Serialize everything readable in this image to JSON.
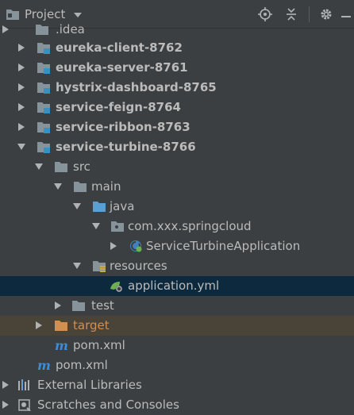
{
  "header": {
    "title": "Project",
    "icons": [
      "folder-icon",
      "dropdown-arrow",
      "locate-icon",
      "collapse-icon",
      "gear-icon",
      "hide-icon"
    ]
  },
  "colors": {
    "background": "#3c3f41",
    "selection": "#0d293e",
    "excluded": "#4a4438",
    "folder": "#87939a",
    "module_badge": "#3592c4",
    "source_folder": "#5a9fd4",
    "target_folder": "#d18f52",
    "text": "#bbbbbb"
  },
  "tree": [
    {
      "label": ".idea",
      "state": "collapsed",
      "icon": "folder-icon",
      "bold": false
    },
    {
      "label": "eureka-client-8762",
      "state": "collapsed",
      "icon": "module-folder-icon",
      "bold": true
    },
    {
      "label": "eureka-server-8761",
      "state": "collapsed",
      "icon": "module-folder-icon",
      "bold": true
    },
    {
      "label": "hystrix-dashboard-8765",
      "state": "collapsed",
      "icon": "module-folder-icon",
      "bold": true
    },
    {
      "label": "service-feign-8764",
      "state": "collapsed",
      "icon": "module-folder-icon",
      "bold": true
    },
    {
      "label": "service-ribbon-8763",
      "state": "collapsed",
      "icon": "module-folder-icon",
      "bold": true
    },
    {
      "label": "service-turbine-8766",
      "state": "expanded",
      "icon": "module-folder-icon",
      "bold": true
    },
    {
      "label": "src",
      "state": "expanded",
      "icon": "folder-icon",
      "bold": false
    },
    {
      "label": "main",
      "state": "expanded",
      "icon": "folder-icon",
      "bold": false
    },
    {
      "label": "java",
      "state": "expanded",
      "icon": "source-folder-icon",
      "bold": false
    },
    {
      "label": "com.xxx.springcloud",
      "state": "expanded",
      "icon": "package-icon",
      "bold": false
    },
    {
      "label": "ServiceTurbineApplication",
      "state": "collapsed",
      "icon": "spring-boot-class-icon",
      "bold": false
    },
    {
      "label": "resources",
      "state": "expanded",
      "icon": "resources-folder-icon",
      "bold": false
    },
    {
      "label": "application.yml",
      "state": "leaf",
      "icon": "spring-config-icon",
      "bold": false,
      "selected": true
    },
    {
      "label": "test",
      "state": "collapsed",
      "icon": "folder-icon",
      "bold": false
    },
    {
      "label": "target",
      "state": "collapsed",
      "icon": "target-folder-icon",
      "bold": false,
      "excluded": true
    },
    {
      "label": "pom.xml",
      "state": "leaf",
      "icon": "maven-icon",
      "bold": false
    },
    {
      "label": "pom.xml",
      "state": "leaf",
      "icon": "maven-icon",
      "bold": false
    },
    {
      "label": "External Libraries",
      "state": "collapsed",
      "icon": "libraries-icon",
      "bold": false
    },
    {
      "label": "Scratches and Consoles",
      "state": "collapsed",
      "icon": "scratches-icon",
      "bold": false
    }
  ]
}
